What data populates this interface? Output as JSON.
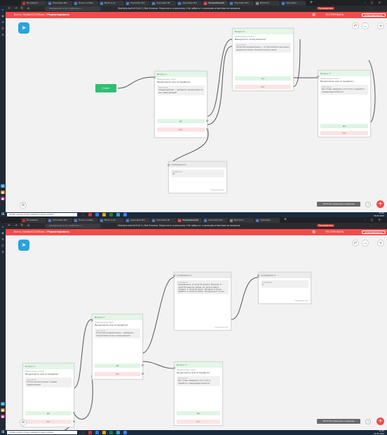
{
  "browser": {
    "tabs": [
      "Входящие",
      "Черновик Blu",
      "Новое сообщ",
      "Black в дл",
      "Черновик Blu",
      "Черновик Bl",
      "Черновик Blu",
      "Черновик Bl",
      "Закрывающий",
      "Черновик Blu",
      "Визитки",
      "Черновик"
    ],
    "url": "starbyte-bot-1-21.chatforms.ru",
    "page_title": "Starbyte-bot1#21b13 | Bot-Кнопки. Переслать в рассылку «Не забыть» с разными ответами на вопросы",
    "ext_label": "Расширения"
  },
  "header": {
    "crumbs_root": "Боты",
    "crumbs_bot": "testbot12345abc",
    "crumbs_current": "Редактировать",
    "test_label": "ТЕСТИРОВАТЬ",
    "publish_label": "ОПУБЛИКОВАТЬ"
  },
  "canvas": {
    "start_label": "Старт",
    "zoom_in": "+",
    "zoom_out": "−",
    "undo": "↶",
    "autosave": "AUTO: Все изменения сохранены",
    "help": "?",
    "fab_plus": "+",
    "map": "⊞"
  },
  "shot1": {
    "nodes": [
      {
        "header": "Вопрос 1",
        "sub": "Предложение ответа",
        "title": "Продолжить или остановить?",
        "caption": "Текст бота",
        "message": "Следующий шаг — выберите, продолжаем ли мы с вами дальше?",
        "yes": "Да",
        "no": "Нет"
      },
      {
        "header": "Вопрос 2",
        "sub": "Предложение ответа",
        "title": "Вернуться к этому вопросу?",
        "caption": "Текст бота",
        "message": "Посмотрите внимательно — в этом вопросе несколько вариантов ответа. Нажмите кнопку ниже",
        "yes": "Да",
        "no": "Нет"
      },
      {
        "header": "Вопрос 3",
        "sub": "Предложение ответа",
        "title": "Продолжить или остановить?",
        "caption": "Текст бота",
        "message": "Вы готовы завершить этот этап и перейти к следующему вопросу?",
        "yes": "Да",
        "no": "Нет"
      },
      {
        "header": "Сообщение 9",
        "sub": "",
        "title": "",
        "caption": "Сообщение",
        "message": "Ок",
        "foot": "Следующий шаг"
      }
    ]
  },
  "shot2": {
    "nodes": [
      {
        "header": "Вопрос 1",
        "sub": "Предложение ответа",
        "title": "Продолжить или остановить?",
        "caption": "Текст бота",
        "message": "Хотите узнать больше о нашем предложении?",
        "yes": "Да",
        "no": "Нет"
      },
      {
        "header": "Вопрос 2",
        "sub": "Предложение ответа",
        "title": "Продолжить или остановить?",
        "caption": "Текст бота",
        "message": "Посмотрите внимательно — выберите, продолжаем ли мы с вами дальше?",
        "yes": "Да",
        "no": "Нет"
      },
      {
        "header": "Сообщение 2",
        "sub": "",
        "title": "",
        "caption": "Сообщение",
        "message": "Понедельник: 9 часов 21 минута. Вторник: 8 часов 32 минуты. Среда: 10 часов 5 минут. Четверг: 7 часов 45 минут. Пятница: 9 часов. Суббота: 6 часов 15 минут. Воскресенье: 4 часа",
        "foot": "Следующий шаг"
      },
      {
        "header": "Вопрос 3",
        "sub": "Предложение ответа",
        "title": "Продолжить или остановить?",
        "caption": "Текст бота",
        "message": "Вы готовы завершить этот этап и перейти к следующему вопросу?",
        "yes": "Да",
        "no": "Нет"
      },
      {
        "header": "Сообщение 3",
        "sub": "",
        "title": "",
        "caption": "Сообщение",
        "message": "А",
        "foot": "Следующий шаг"
      }
    ]
  },
  "taskbar": {
    "search_placeholder": "Чтобы начать поиск, введите здесь запрос",
    "time": "12:22",
    "date": "16.05.2022",
    "lang": "РУС"
  },
  "colors": {
    "brand_red": "#f24b4b",
    "start_green": "#2fbf71",
    "telegram_blue": "#2aa3dd"
  }
}
